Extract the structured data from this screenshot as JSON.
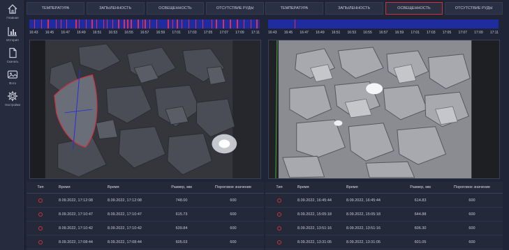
{
  "sidebar": {
    "items": [
      {
        "label": "Главная",
        "icon": "home-icon"
      },
      {
        "label": "История",
        "icon": "chart-icon"
      },
      {
        "label": "Скачать",
        "icon": "document-icon"
      },
      {
        "label": "Фото",
        "icon": "image-icon"
      },
      {
        "label": "Настройки",
        "icon": "gear-icon"
      }
    ]
  },
  "colors": {
    "background": "#1f2436",
    "accent": "#d0303a",
    "timeline": "#1e2ca0"
  },
  "panels": [
    {
      "tabs": [
        "ТЕМПЕРАТУРА",
        "ЗАПЫЛЕННОСТЬ",
        "ОСВЕЩЕННОСТЬ",
        "ОТСУТСТВИЕ РУДЫ"
      ],
      "active_tab": -1,
      "timeline": {
        "ticks": [
          "16:43",
          "16:45",
          "16:47",
          "16:49",
          "16:51",
          "16:53",
          "16:55",
          "16:57",
          "16:59",
          "17:01",
          "17:03",
          "17:05",
          "17:07",
          "17:09",
          "17:11"
        ],
        "marks": [
          0.02,
          0.05,
          0.08,
          0.115,
          0.135,
          0.16,
          0.2,
          0.215,
          0.245,
          0.27,
          0.29,
          0.32,
          0.335,
          0.36,
          0.385,
          0.41,
          0.425,
          0.44,
          0.47,
          0.49,
          0.5,
          0.52,
          0.55,
          0.6,
          0.62,
          0.64,
          0.66,
          0.69,
          0.72,
          0.75,
          0.79,
          0.81,
          0.84,
          0.87,
          0.9,
          0.93,
          0.96,
          0.985
        ]
      },
      "table": {
        "headers": [
          "Тип",
          "Время",
          "Время",
          "Размер, мм",
          "Пороговое значение"
        ],
        "rows": [
          {
            "time1": "8.09.2022, 17:12:08",
            "time2": "8.09.2022, 17:12:08",
            "size": "748.00",
            "threshold": "600"
          },
          {
            "time1": "8.09.2022, 17:10:47",
            "time2": "8.09.2022, 17:10:47",
            "size": "615.73",
            "threshold": "600"
          },
          {
            "time1": "8.09.2022, 17:10:42",
            "time2": "8.09.2022, 17:10:42",
            "size": "639.84",
            "threshold": "600"
          },
          {
            "time1": "8.09.2022, 17:08:44",
            "time2": "8.09.2022, 17:08:44",
            "size": "605.03",
            "threshold": "600"
          }
        ]
      }
    },
    {
      "tabs": [
        "ТЕМПЕРАТУРА",
        "ЗАПЫЛЕННОСТЬ",
        "ОСВЕЩЕННОСТЬ",
        "ОТСУТСТВИЕ РУДЫ"
      ],
      "active_tab": 2,
      "timeline": {
        "ticks": [
          "16:43",
          "16:45",
          "16:47",
          "16:49",
          "16:51",
          "16:53",
          "16:55",
          "16:57",
          "16:59",
          "17:01",
          "17:03",
          "17:05",
          "17:07",
          "17:09",
          "17:11"
        ],
        "marks": [
          0.115
        ]
      },
      "table": {
        "headers": [
          "Тип",
          "Время",
          "Время",
          "Размер, мм",
          "Пороговое значение"
        ],
        "rows": [
          {
            "time1": "8.09.2022, 16:45:44",
            "time2": "8.09.2022, 16:45:44",
            "size": "614.83",
            "threshold": "600"
          },
          {
            "time1": "8.09.2022, 15:05:18",
            "time2": "8.09.2022, 15:05:18",
            "size": "644.88",
            "threshold": "600"
          },
          {
            "time1": "8.09.2022, 13:51:16",
            "time2": "8.09.2022, 13:51:16",
            "size": "606.30",
            "threshold": "600"
          },
          {
            "time1": "8.09.2022, 13:31:05",
            "time2": "8.09.2022, 13:31:05",
            "size": "601.05",
            "threshold": "600"
          }
        ]
      }
    }
  ]
}
